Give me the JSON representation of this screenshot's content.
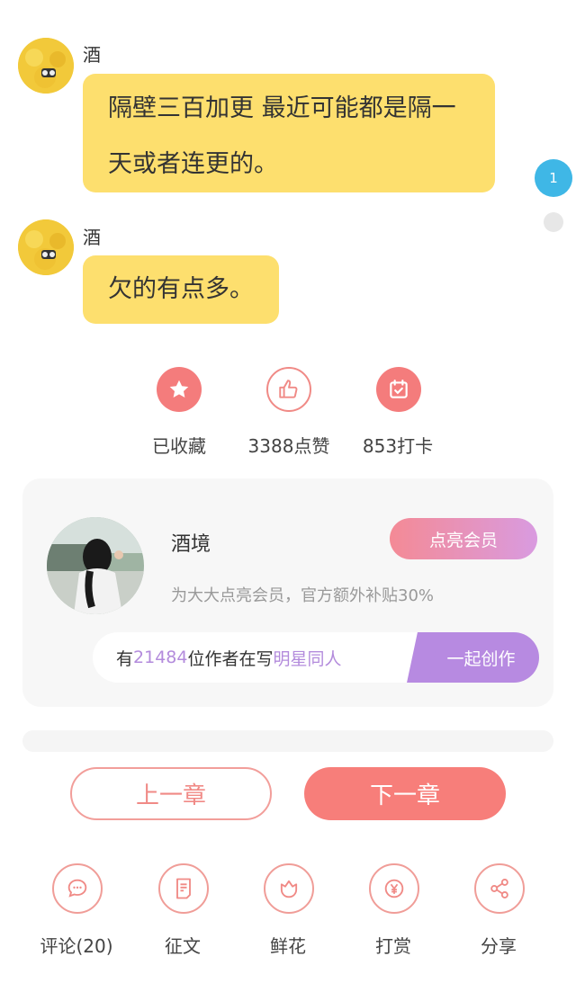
{
  "messages": [
    {
      "author": "酒",
      "text": "隔壁三百加更 最近可能都是隔一天或者连更的。"
    },
    {
      "author": "酒",
      "text": "欠的有点多。"
    }
  ],
  "comment_count": "1",
  "stats": {
    "favorite_label": "已收藏",
    "like_label": "3388点赞",
    "checkin_label": "853打卡"
  },
  "author_card": {
    "name": "酒境",
    "member_button": "点亮会员",
    "promo": "为大大点亮会员，官方额外补贴30%",
    "writers_prefix": "有",
    "writers_count": "21484",
    "writers_middle": "位作者在写",
    "writers_topic": "明星同人",
    "create_button": "一起创作"
  },
  "navigation": {
    "prev": "上一章",
    "next": "下一章"
  },
  "bottom_actions": [
    {
      "label": "评论(20)",
      "icon": "comment-icon"
    },
    {
      "label": "征文",
      "icon": "essay-icon"
    },
    {
      "label": "鲜花",
      "icon": "flower-icon"
    },
    {
      "label": "打赏",
      "icon": "reward-icon"
    },
    {
      "label": "分享",
      "icon": "share-icon"
    }
  ],
  "colors": {
    "bubble": "#fddf6e",
    "accent": "#f77e7a",
    "purple": "#b78ae1",
    "comment_badge": "#3fb7e6"
  }
}
